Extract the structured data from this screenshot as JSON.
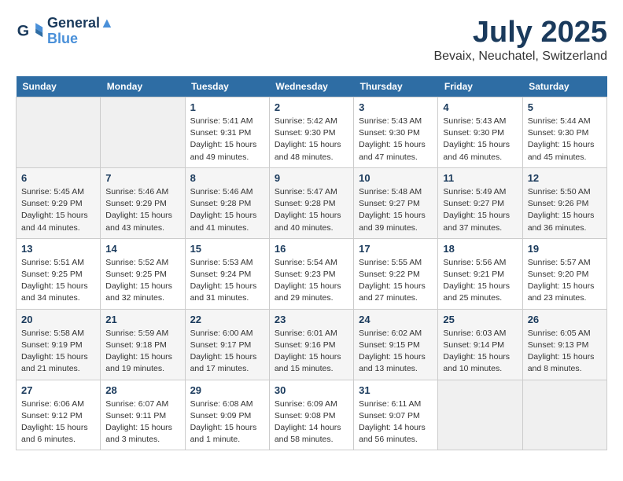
{
  "header": {
    "logo_line1": "General",
    "logo_line2": "Blue",
    "title": "July 2025",
    "subtitle": "Bevaix, Neuchatel, Switzerland"
  },
  "weekdays": [
    "Sunday",
    "Monday",
    "Tuesday",
    "Wednesday",
    "Thursday",
    "Friday",
    "Saturday"
  ],
  "weeks": [
    [
      {
        "day": "",
        "info": ""
      },
      {
        "day": "",
        "info": ""
      },
      {
        "day": "1",
        "info": "Sunrise: 5:41 AM\nSunset: 9:31 PM\nDaylight: 15 hours and 49 minutes."
      },
      {
        "day": "2",
        "info": "Sunrise: 5:42 AM\nSunset: 9:30 PM\nDaylight: 15 hours and 48 minutes."
      },
      {
        "day": "3",
        "info": "Sunrise: 5:43 AM\nSunset: 9:30 PM\nDaylight: 15 hours and 47 minutes."
      },
      {
        "day": "4",
        "info": "Sunrise: 5:43 AM\nSunset: 9:30 PM\nDaylight: 15 hours and 46 minutes."
      },
      {
        "day": "5",
        "info": "Sunrise: 5:44 AM\nSunset: 9:30 PM\nDaylight: 15 hours and 45 minutes."
      }
    ],
    [
      {
        "day": "6",
        "info": "Sunrise: 5:45 AM\nSunset: 9:29 PM\nDaylight: 15 hours and 44 minutes."
      },
      {
        "day": "7",
        "info": "Sunrise: 5:46 AM\nSunset: 9:29 PM\nDaylight: 15 hours and 43 minutes."
      },
      {
        "day": "8",
        "info": "Sunrise: 5:46 AM\nSunset: 9:28 PM\nDaylight: 15 hours and 41 minutes."
      },
      {
        "day": "9",
        "info": "Sunrise: 5:47 AM\nSunset: 9:28 PM\nDaylight: 15 hours and 40 minutes."
      },
      {
        "day": "10",
        "info": "Sunrise: 5:48 AM\nSunset: 9:27 PM\nDaylight: 15 hours and 39 minutes."
      },
      {
        "day": "11",
        "info": "Sunrise: 5:49 AM\nSunset: 9:27 PM\nDaylight: 15 hours and 37 minutes."
      },
      {
        "day": "12",
        "info": "Sunrise: 5:50 AM\nSunset: 9:26 PM\nDaylight: 15 hours and 36 minutes."
      }
    ],
    [
      {
        "day": "13",
        "info": "Sunrise: 5:51 AM\nSunset: 9:25 PM\nDaylight: 15 hours and 34 minutes."
      },
      {
        "day": "14",
        "info": "Sunrise: 5:52 AM\nSunset: 9:25 PM\nDaylight: 15 hours and 32 minutes."
      },
      {
        "day": "15",
        "info": "Sunrise: 5:53 AM\nSunset: 9:24 PM\nDaylight: 15 hours and 31 minutes."
      },
      {
        "day": "16",
        "info": "Sunrise: 5:54 AM\nSunset: 9:23 PM\nDaylight: 15 hours and 29 minutes."
      },
      {
        "day": "17",
        "info": "Sunrise: 5:55 AM\nSunset: 9:22 PM\nDaylight: 15 hours and 27 minutes."
      },
      {
        "day": "18",
        "info": "Sunrise: 5:56 AM\nSunset: 9:21 PM\nDaylight: 15 hours and 25 minutes."
      },
      {
        "day": "19",
        "info": "Sunrise: 5:57 AM\nSunset: 9:20 PM\nDaylight: 15 hours and 23 minutes."
      }
    ],
    [
      {
        "day": "20",
        "info": "Sunrise: 5:58 AM\nSunset: 9:19 PM\nDaylight: 15 hours and 21 minutes."
      },
      {
        "day": "21",
        "info": "Sunrise: 5:59 AM\nSunset: 9:18 PM\nDaylight: 15 hours and 19 minutes."
      },
      {
        "day": "22",
        "info": "Sunrise: 6:00 AM\nSunset: 9:17 PM\nDaylight: 15 hours and 17 minutes."
      },
      {
        "day": "23",
        "info": "Sunrise: 6:01 AM\nSunset: 9:16 PM\nDaylight: 15 hours and 15 minutes."
      },
      {
        "day": "24",
        "info": "Sunrise: 6:02 AM\nSunset: 9:15 PM\nDaylight: 15 hours and 13 minutes."
      },
      {
        "day": "25",
        "info": "Sunrise: 6:03 AM\nSunset: 9:14 PM\nDaylight: 15 hours and 10 minutes."
      },
      {
        "day": "26",
        "info": "Sunrise: 6:05 AM\nSunset: 9:13 PM\nDaylight: 15 hours and 8 minutes."
      }
    ],
    [
      {
        "day": "27",
        "info": "Sunrise: 6:06 AM\nSunset: 9:12 PM\nDaylight: 15 hours and 6 minutes."
      },
      {
        "day": "28",
        "info": "Sunrise: 6:07 AM\nSunset: 9:11 PM\nDaylight: 15 hours and 3 minutes."
      },
      {
        "day": "29",
        "info": "Sunrise: 6:08 AM\nSunset: 9:09 PM\nDaylight: 15 hours and 1 minute."
      },
      {
        "day": "30",
        "info": "Sunrise: 6:09 AM\nSunset: 9:08 PM\nDaylight: 14 hours and 58 minutes."
      },
      {
        "day": "31",
        "info": "Sunrise: 6:11 AM\nSunset: 9:07 PM\nDaylight: 14 hours and 56 minutes."
      },
      {
        "day": "",
        "info": ""
      },
      {
        "day": "",
        "info": ""
      }
    ]
  ]
}
